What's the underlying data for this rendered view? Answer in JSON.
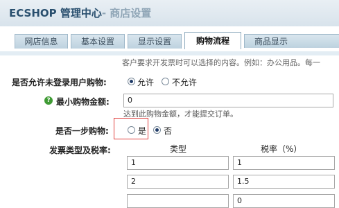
{
  "header": {
    "app_title": "ECSHOP 管理中心",
    "page_title": "- 商店设置"
  },
  "tabs": [
    {
      "label": "网店信息"
    },
    {
      "label": "基本设置"
    },
    {
      "label": "显示设置"
    },
    {
      "label": "购物流程"
    },
    {
      "label": "商品显示"
    }
  ],
  "form": {
    "top_note": "客户要求开发票时可以选择的内容。例如：办公用品。每一",
    "guest_checkout": {
      "label": "是否允许未登录用户购物:",
      "options": [
        "允许",
        "不允许"
      ],
      "selected": "允许"
    },
    "min_order": {
      "label": "最小购物金额:",
      "value": "0",
      "hint": "达到此购物金额，才能提交订单。"
    },
    "one_step": {
      "label": "是否一步购物:",
      "options": [
        "是",
        "否"
      ],
      "selected": "否"
    },
    "invoice": {
      "label": "发票类型及税率:",
      "col_type": "类型",
      "col_rate": "税率（%）",
      "rows": [
        {
          "type": "1",
          "rate": "1"
        },
        {
          "type": "2",
          "rate": "1.5"
        },
        {
          "type": "",
          "rate": "0"
        }
      ]
    }
  },
  "colors": {
    "brand": "#294f6e",
    "subtitle": "#8fa5b6",
    "tab_bg": "#bdd2df",
    "help_icon": "#3f9b34",
    "highlight": "#e0403e"
  }
}
